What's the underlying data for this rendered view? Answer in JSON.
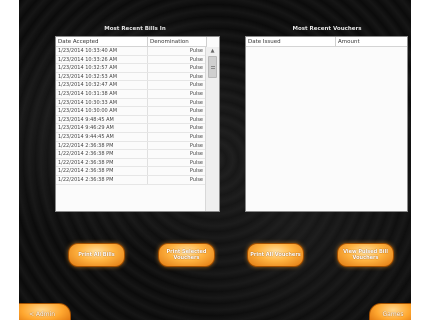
{
  "bills_panel": {
    "title": "Most Recent Bills In",
    "columns": {
      "date": "Date Accepted",
      "denomination": "Denomination"
    },
    "rows": [
      {
        "date": "1/23/2014 10:33:40 AM",
        "denomination": "Pulse"
      },
      {
        "date": "1/23/2014 10:33:26 AM",
        "denomination": "Pulse"
      },
      {
        "date": "1/23/2014 10:32:57 AM",
        "denomination": "Pulse"
      },
      {
        "date": "1/23/2014 10:32:53 AM",
        "denomination": "Pulse"
      },
      {
        "date": "1/23/2014 10:32:47 AM",
        "denomination": "Pulse"
      },
      {
        "date": "1/23/2014 10:31:38 AM",
        "denomination": "Pulse"
      },
      {
        "date": "1/23/2014 10:30:33 AM",
        "denomination": "Pulse"
      },
      {
        "date": "1/23/2014 10:30:00 AM",
        "denomination": "Pulse"
      },
      {
        "date": "1/23/2014 9:48:45 AM",
        "denomination": "Pulse"
      },
      {
        "date": "1/23/2014 9:46:29 AM",
        "denomination": "Pulse"
      },
      {
        "date": "1/23/2014 9:44:45 AM",
        "denomination": "Pulse"
      },
      {
        "date": "1/22/2014 2:36:38 PM",
        "denomination": "Pulse"
      },
      {
        "date": "1/22/2014 2:36:38 PM",
        "denomination": "Pulse"
      },
      {
        "date": "1/22/2014 2:36:38 PM",
        "denomination": "Pulse"
      },
      {
        "date": "1/22/2014 2:36:38 PM",
        "denomination": "Pulse"
      },
      {
        "date": "1/22/2014 2:36:38 PM",
        "denomination": "Pulse"
      }
    ]
  },
  "vouchers_panel": {
    "title": "Most Recent Vouchers",
    "columns": {
      "date": "Date Issued",
      "amount": "Amount"
    }
  },
  "buttons": {
    "print_all_bills": "Print All Bills",
    "print_selected_vouchers": "Print Selected Vouchers",
    "print_all_vouchers": "Print All Vouchers",
    "view_pulsed_bill_vouchers": "View Pulsed Bill Vouchers",
    "admin": "< Admin",
    "games": "Games"
  },
  "colors": {
    "background": "#0b0b0b",
    "button_orange": "#ffb340",
    "panel_bg": "#fbfbfb"
  }
}
